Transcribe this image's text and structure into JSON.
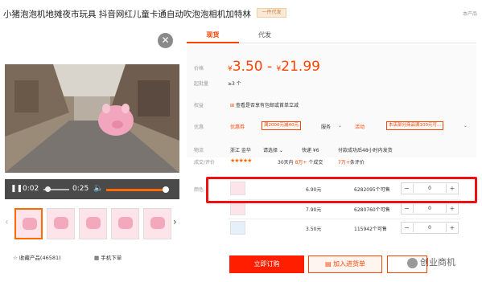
{
  "product": {
    "title": "小猪泡泡机地摊夜市玩具 抖音网红儿童卡通自动吹泡泡相机加特林",
    "badge": "一件代发",
    "corner": "本产品"
  },
  "player": {
    "current": "0:02",
    "duration": "0:25",
    "progress": 0.08,
    "volume": 0.95
  },
  "gallery": {
    "count": 5,
    "active_index": 0
  },
  "bottom_left": {
    "favorite": "收藏产品(46581)",
    "mobile_order": "手机下单"
  },
  "tabs": [
    {
      "label": "现货",
      "active": true
    },
    {
      "label": "代发",
      "active": false
    }
  ],
  "info": {
    "price_label": "价格",
    "price_low": "3.50",
    "price_sep": "-",
    "price_high": "21.99",
    "currency": "¥",
    "moq_label": "起批量",
    "moq_value": "≥3 个",
    "rights_label": "权益",
    "rights_value": "查看是否享有包邮或首单立减",
    "discount_label": "优惠",
    "discount_tag": "优惠券",
    "coupon1": "满2000元减40元",
    "service_label": "服务",
    "promo_tag": "活动",
    "coupon2": "本店部分商品满100元可...",
    "shipping_label": "物流",
    "ship_from": "浙江 金华",
    "ship_to": "请选择",
    "express": "快递 ¥6",
    "ship_note": "付款成功后48小时内发货",
    "rating_label": "成交/评价",
    "stars": "★★★★★",
    "deals_a": "30天内",
    "deals_b": "8万+",
    "deals_c": "个成交",
    "reviews_a": "7万+",
    "reviews_b": "条评价",
    "color_label": "颜色"
  },
  "skus": [
    {
      "price": "6.90元",
      "stock": "6282095个可售",
      "qty": "0"
    },
    {
      "price": "7.90元",
      "stock": "6280760个可售",
      "qty": "0"
    },
    {
      "price": "3.50元",
      "stock": "115942个可售",
      "qty": "0"
    }
  ],
  "actions": {
    "order": "立即订购",
    "cart": "加入进货单"
  },
  "watermark": "创业商机",
  "colors": {
    "accent": "#ff4400",
    "highlight": "#ee1111",
    "order_button": "#ff1e00"
  }
}
